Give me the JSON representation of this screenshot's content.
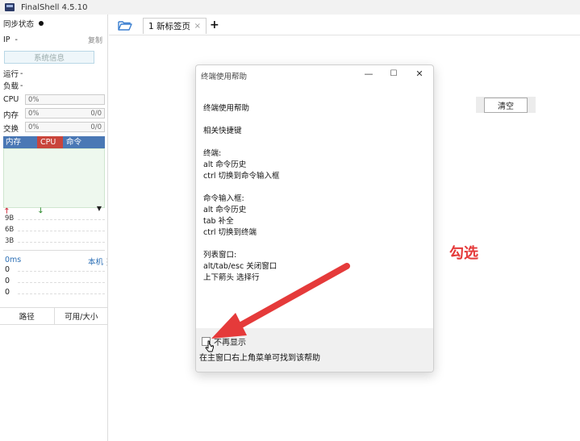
{
  "window": {
    "title": "FinalShell 4.5.10"
  },
  "sidebar": {
    "sync_status": "同步状态",
    "ip_label": "IP",
    "ip_value": "-",
    "copy": "复制",
    "sysinfo": "系统信息",
    "uptime_label": "运行",
    "uptime_value": "-",
    "load_label": "负载",
    "load_value": "-",
    "cpu_label": "CPU",
    "cpu_value": "0%",
    "mem_label": "内存",
    "mem_value": "0%",
    "mem_total": "0/0",
    "swap_label": "交换",
    "swap_value": "0%",
    "swap_total": "0/0",
    "proc_tabs": [
      "内存",
      "CPU",
      "命令"
    ],
    "net_scale": [
      "9B",
      "6B",
      "3B"
    ],
    "ping_ms": "0ms",
    "ping_host": "本机",
    "ping_values": [
      "0",
      "0",
      "0"
    ],
    "file_cols": [
      "路径",
      "可用/大小"
    ]
  },
  "tabs": {
    "active_label": "1 新标签页",
    "close": "×",
    "add": "+"
  },
  "workspace": {
    "clear": "清空"
  },
  "dialog": {
    "title": "终端使用帮助",
    "lines": [
      "终端使用帮助",
      "相关快捷键",
      "终端:",
      "alt 命令历史",
      "ctrl 切换到命令输入框",
      "命令输入框:",
      "alt 命令历史",
      "tab 补全",
      "ctrl 切换到终端",
      "列表窗口:",
      "alt/tab/esc 关闭窗口",
      "上下箭头 选择行"
    ],
    "dont_show": "不再显示",
    "footer_note": "在主窗口右上角菜单可找到该帮助",
    "dont_show_checked": false
  },
  "annotation": {
    "label": "勾选",
    "color": "#e53a3a"
  }
}
